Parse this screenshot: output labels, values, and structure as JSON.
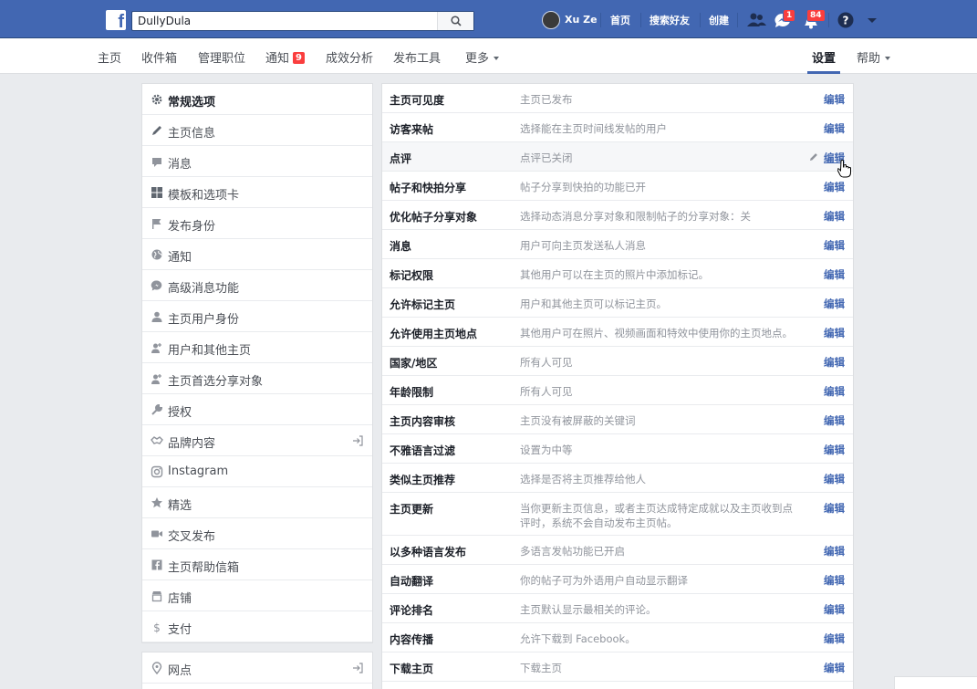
{
  "header": {
    "search_value": "DullyDula",
    "user_name": "Xu Ze",
    "nav": [
      "首页",
      "搜索好友",
      "创建"
    ],
    "badges": {
      "messages": "1",
      "notifications": "84"
    }
  },
  "subnav": {
    "tabs": [
      "主页",
      "收件箱",
      "管理职位",
      "通知",
      "成效分析",
      "发布工具",
      "更多"
    ],
    "notification_count": "9",
    "settings": "设置",
    "help": "帮助"
  },
  "sidebar": {
    "items": [
      {
        "label": "常规选项",
        "icon": "gear-icon"
      },
      {
        "label": "主页信息",
        "icon": "pencil-icon"
      },
      {
        "label": "消息",
        "icon": "chat-icon"
      },
      {
        "label": "模板和选项卡",
        "icon": "grid-icon"
      },
      {
        "label": "发布身份",
        "icon": "flag-icon"
      },
      {
        "label": "通知",
        "icon": "globe-icon"
      },
      {
        "label": "高级消息功能",
        "icon": "messenger-icon"
      },
      {
        "label": "主页用户身份",
        "icon": "person-icon"
      },
      {
        "label": "用户和其他主页",
        "icon": "person-plus-icon"
      },
      {
        "label": "主页首选分享对象",
        "icon": "person-plus-icon"
      },
      {
        "label": "授权",
        "icon": "wrench-icon"
      },
      {
        "label": "品牌内容",
        "icon": "handshake-icon"
      },
      {
        "label": "Instagram",
        "icon": "instagram-icon"
      },
      {
        "label": "精选",
        "icon": "star-icon"
      },
      {
        "label": "交叉发布",
        "icon": "video-icon"
      },
      {
        "label": "主页帮助信箱",
        "icon": "facebook-icon"
      },
      {
        "label": "店铺",
        "icon": "shop-icon"
      },
      {
        "label": "支付",
        "icon": "dollar-icon"
      }
    ],
    "second": {
      "label": "网点",
      "icon": "pin-icon"
    }
  },
  "settings": {
    "edit_label": "编辑",
    "rows": [
      {
        "key": "主页可见度",
        "value": "主页已发布"
      },
      {
        "key": "访客来帖",
        "value": "选择能在主页时间线发帖的用户"
      },
      {
        "key": "点评",
        "value": "点评已关闭"
      },
      {
        "key": "帖子和快拍分享",
        "value": "帖子分享到快拍的功能已开"
      },
      {
        "key": "优化帖子分享对象",
        "value": "选择动态消息分享对象和限制帖子的分享对象：关"
      },
      {
        "key": "消息",
        "value": "用户可向主页发送私人消息"
      },
      {
        "key": "标记权限",
        "value": "其他用户可以在主页的照片中添加标记。"
      },
      {
        "key": "允许标记主页",
        "value": "用户和其他主页可以标记主页。"
      },
      {
        "key": "允许使用主页地点",
        "value": "其他用户可在照片、视频画面和特效中使用你的主页地点。"
      },
      {
        "key": "国家/地区",
        "value": "所有人可见"
      },
      {
        "key": "年龄限制",
        "value": "所有人可见"
      },
      {
        "key": "主页内容审核",
        "value": "主页没有被屏蔽的关键词"
      },
      {
        "key": "不雅语言过滤",
        "value": "设置为中等"
      },
      {
        "key": "类似主页推荐",
        "value": "选择是否将主页推荐给他人"
      },
      {
        "key": "主页更新",
        "value": "当你更新主页信息，或者主页达成特定成就以及主页收到点评时，系统不会自动发布主页帖。"
      },
      {
        "key": "以多种语言发布",
        "value": "多语言发帖功能已开启"
      },
      {
        "key": "自动翻译",
        "value": "你的帖子可为外语用户自动显示翻译"
      },
      {
        "key": "评论排名",
        "value": "主页默认显示最相关的评论。"
      },
      {
        "key": "内容传播",
        "value": "允许下载到 Facebook。"
      },
      {
        "key": "下载主页",
        "value": "下载主页"
      }
    ]
  }
}
